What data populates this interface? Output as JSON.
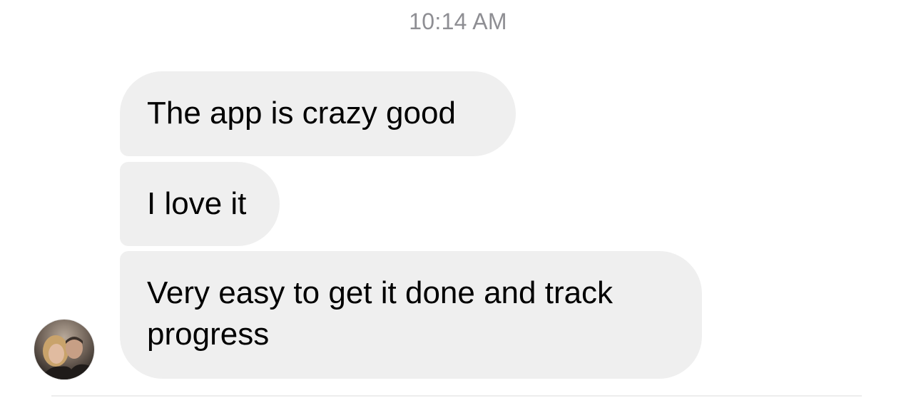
{
  "chat": {
    "timestamp": "10:14 AM",
    "messages": [
      {
        "text": "The app is crazy good"
      },
      {
        "text": "I love it"
      },
      {
        "text": "Very easy to get it done and track progress"
      }
    ],
    "sender_avatar": {
      "icon": "profile-photo-avatar"
    }
  },
  "colors": {
    "bubble_background": "#efefef",
    "timestamp_text": "#8e8e93",
    "message_text": "#000000"
  }
}
